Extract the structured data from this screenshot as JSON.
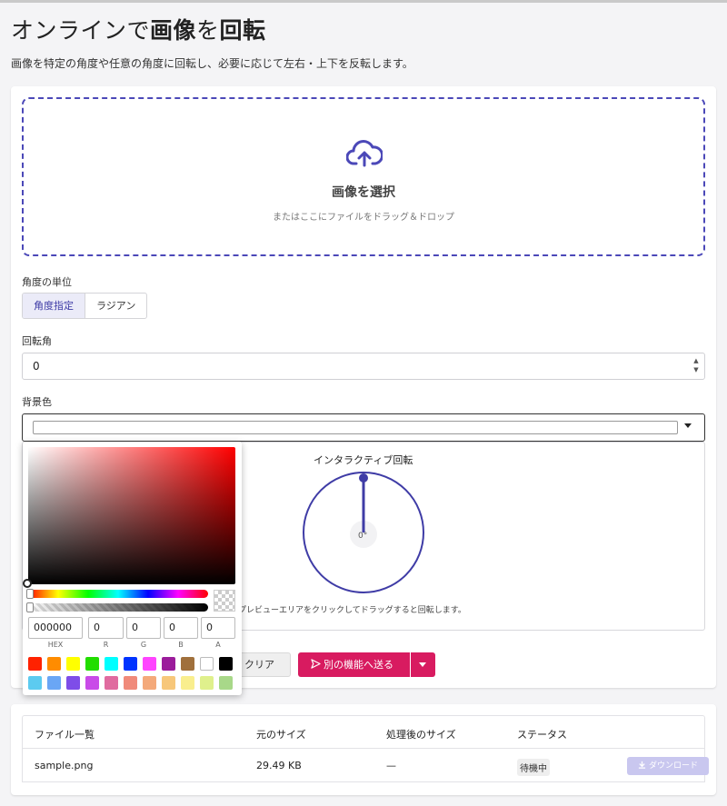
{
  "page": {
    "title_pre": "オンラインで",
    "title_b1": "画像",
    "title_mid": "を",
    "title_b2": "回転",
    "subtitle": "画像を特定の角度や任意の角度に回転し、必要に応じて左右・上下を反転します。"
  },
  "dropzone": {
    "title": "画像を選択",
    "subtitle": "またはここにファイルをドラッグ＆ドロップ",
    "icon": "cloud-upload-icon"
  },
  "angle_unit": {
    "label": "角度の単位",
    "options": [
      "角度指定",
      "ラジアン"
    ],
    "selected": "角度指定"
  },
  "rotation": {
    "label": "回転角",
    "value": "0"
  },
  "background": {
    "label": "背景色"
  },
  "color_picker": {
    "hex": "000000",
    "r": "0",
    "g": "0",
    "b": "0",
    "a": "0",
    "labels": [
      "HEX",
      "R",
      "G",
      "B",
      "A"
    ],
    "presets": [
      "#ff2200",
      "#ff8c00",
      "#ffff00",
      "#22dd00",
      "#00ffff",
      "#0033ff",
      "#ff44ff",
      "#9b1c9b",
      "#a0703c",
      "#ffffff",
      "#000000",
      "#5ccbf0",
      "#6aa6f5",
      "#7e4de8",
      "#c94be8",
      "#e06b9f",
      "#f08a7a",
      "#f4a97a",
      "#f7c77a",
      "#f9ee8e",
      "#dff08c",
      "#a8d889"
    ]
  },
  "interactive": {
    "label": "インタラクティブ回転",
    "angle_display": "0°",
    "hint": "プレビューエリアをクリックしてドラッグすると回転します。"
  },
  "actions": {
    "clear": "クリア",
    "send": "別の機能へ送る"
  },
  "files": {
    "headers": [
      "ファイル一覧",
      "元のサイズ",
      "処理後のサイズ",
      "ステータス"
    ],
    "rows": [
      {
        "name": "sample.png",
        "size": "29.49 KB",
        "processed": "—",
        "status": "待機中",
        "download": "ダウンロード"
      }
    ]
  },
  "colors": {
    "accent": "#4b48b8",
    "send_button": "#d81b60"
  }
}
